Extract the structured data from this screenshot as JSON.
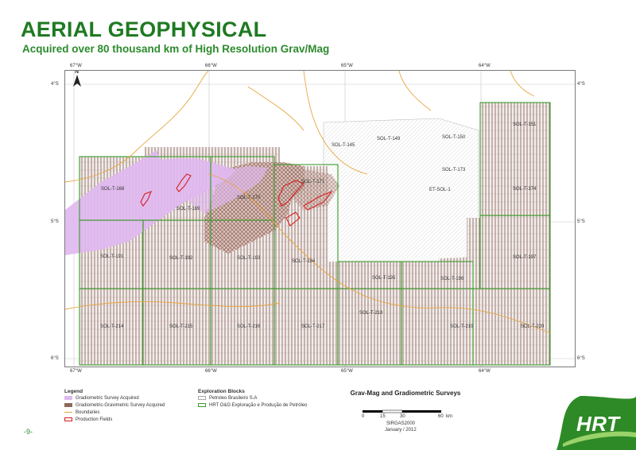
{
  "header": {
    "title": "AERIAL GEOPHYSICAL",
    "subtitle": "Acquired over 80 thousand km of High Resolution Grav/Mag"
  },
  "map": {
    "top_labels": [
      "67°W",
      "66°W",
      "65°W",
      "64°W"
    ],
    "bottom_labels": [
      "67°W",
      "66°W",
      "65°W",
      "64°W"
    ],
    "left_labels": [
      "4°S",
      "5°S",
      "6°S"
    ],
    "right_labels": [
      "4°S",
      "5°S",
      "6°S"
    ],
    "north_label": "N",
    "blocks": [
      "SOL-T-145",
      "SOL-T-149",
      "SOL-T-150",
      "SOL-T-151",
      "SOL-T-173",
      "SOL-T-174",
      "SOL-T-168",
      "SOL-T-169",
      "SOL-T-170",
      "SOL-T-171",
      "ET-SOL-1",
      "SOL-T-191",
      "SOL-T-192",
      "SOL-T-193",
      "SOL-T-194",
      "SOL-T-195",
      "SOL-T-196",
      "SOL-T-197",
      "SOL-T-214",
      "SOL-T-215",
      "SOL-T-216",
      "SOL-T-217",
      "SOL-T-218",
      "SOL-T-219",
      "SOL-T-220"
    ]
  },
  "legend": {
    "title": "Legend",
    "items": [
      {
        "label": "Gradiometric Survey Acquired",
        "color": "#e0b8f0"
      },
      {
        "label": "Gradiometric-Gravimetric Survey Acquired",
        "color": "#8b6a5a"
      },
      {
        "label": "Boundaries",
        "color": "#e8a640"
      },
      {
        "label": "Production Fields",
        "color": "#d62020"
      }
    ]
  },
  "exploration_blocks": {
    "title": "Exploration Blocks",
    "items": [
      {
        "label": "Petroleo Brasileiro S.A",
        "color": "#cccccc"
      },
      {
        "label": "HRT O&G Exploração e Produção de Petróleo",
        "color": "#3a9a2a"
      }
    ]
  },
  "panel": {
    "title": "Grav-Mag and Gradiometric Surveys",
    "scale_ticks": [
      "0",
      "15",
      "30",
      "60"
    ],
    "scale_unit": "km",
    "datum": "SIRGAS2000",
    "date": "January / 2012"
  },
  "footer": {
    "page_number": "-9-",
    "logo_text": "HRT"
  },
  "colors": {
    "title_green": "#1f7a22",
    "hrt_green": "#3a9a2a",
    "survey_lines": "#8b6a5a",
    "gradiometric": "#e0b8f0",
    "production": "#d62020",
    "boundary": "#e8a640"
  }
}
